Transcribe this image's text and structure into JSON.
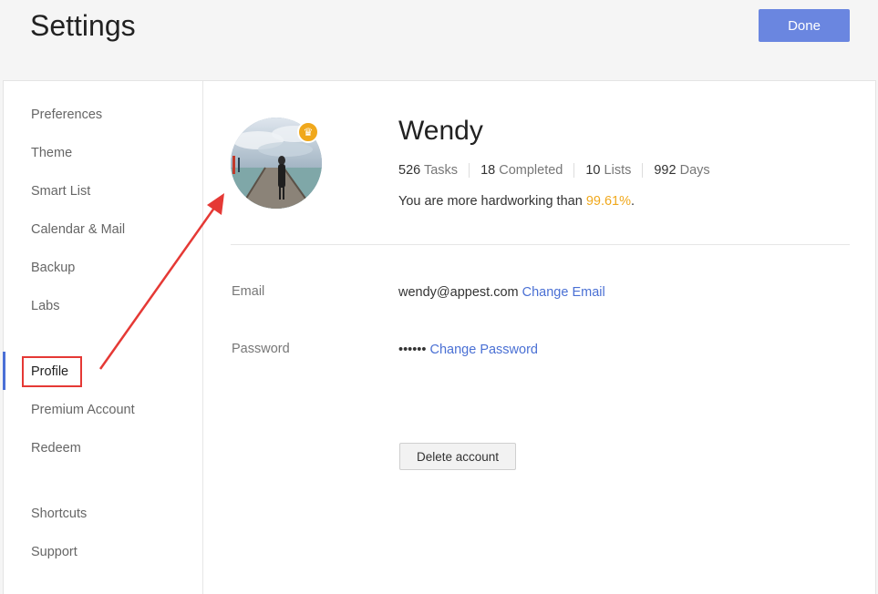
{
  "header": {
    "title": "Settings",
    "done_label": "Done"
  },
  "sidebar": {
    "items": [
      {
        "label": "Preferences"
      },
      {
        "label": "Theme"
      },
      {
        "label": "Smart List"
      },
      {
        "label": "Calendar & Mail"
      },
      {
        "label": "Backup"
      },
      {
        "label": "Labs"
      },
      {
        "label": "Profile",
        "active": true
      },
      {
        "label": "Premium Account"
      },
      {
        "label": "Redeem"
      },
      {
        "label": "Shortcuts"
      },
      {
        "label": "Support"
      }
    ]
  },
  "profile": {
    "name": "Wendy",
    "stats": [
      {
        "num": "526",
        "unit": "Tasks"
      },
      {
        "num": "18",
        "unit": "Completed"
      },
      {
        "num": "10",
        "unit": "Lists"
      },
      {
        "num": "992",
        "unit": "Days"
      }
    ],
    "hardworking_prefix": "You are more hardworking than ",
    "hardworking_pct": "99.61%",
    "hardworking_suffix": "."
  },
  "account": {
    "email_label": "Email",
    "email_value": "wendy@appest.com",
    "change_email": "Change Email",
    "password_label": "Password",
    "password_value": "••••••",
    "change_password": "Change Password",
    "delete_label": "Delete account"
  },
  "colors": {
    "accent": "#6a86e0",
    "link": "#4a70d4",
    "highlight": "#f0a81c",
    "annotation": "#e53935"
  },
  "icons": {
    "crown": "crown-icon",
    "avatar": "avatar"
  }
}
